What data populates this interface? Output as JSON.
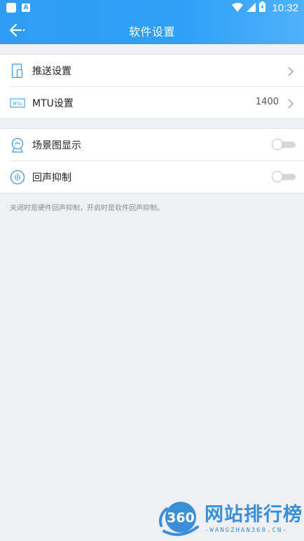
{
  "status_bar": {
    "time": "10:32"
  },
  "header": {
    "title": "软件设置"
  },
  "groups": [
    {
      "items": [
        {
          "label": "推送设置",
          "value": "",
          "control": "chevron",
          "icon": "push-phone-icon"
        },
        {
          "label": "MTU设置",
          "value": "1400",
          "control": "chevron",
          "icon": "mtu-icon",
          "icon_text": "MTU"
        }
      ]
    },
    {
      "items": [
        {
          "label": "场景图显示",
          "control": "toggle",
          "checked": false,
          "icon": "scene-camera-icon"
        },
        {
          "label": "回声抑制",
          "control": "toggle",
          "checked": false,
          "icon": "echo-wave-icon"
        }
      ]
    }
  ],
  "hint": "关闭时是硬件回声抑制，开启时是软件回声抑制。",
  "watermark": {
    "logo_text": "360",
    "title": "网站排行榜",
    "subtitle": "-WANGZHAN360.CN-"
  },
  "colors": {
    "header": "#2e9ff5",
    "background": "#eff0f4",
    "icon_accent": "#3a9be8"
  }
}
